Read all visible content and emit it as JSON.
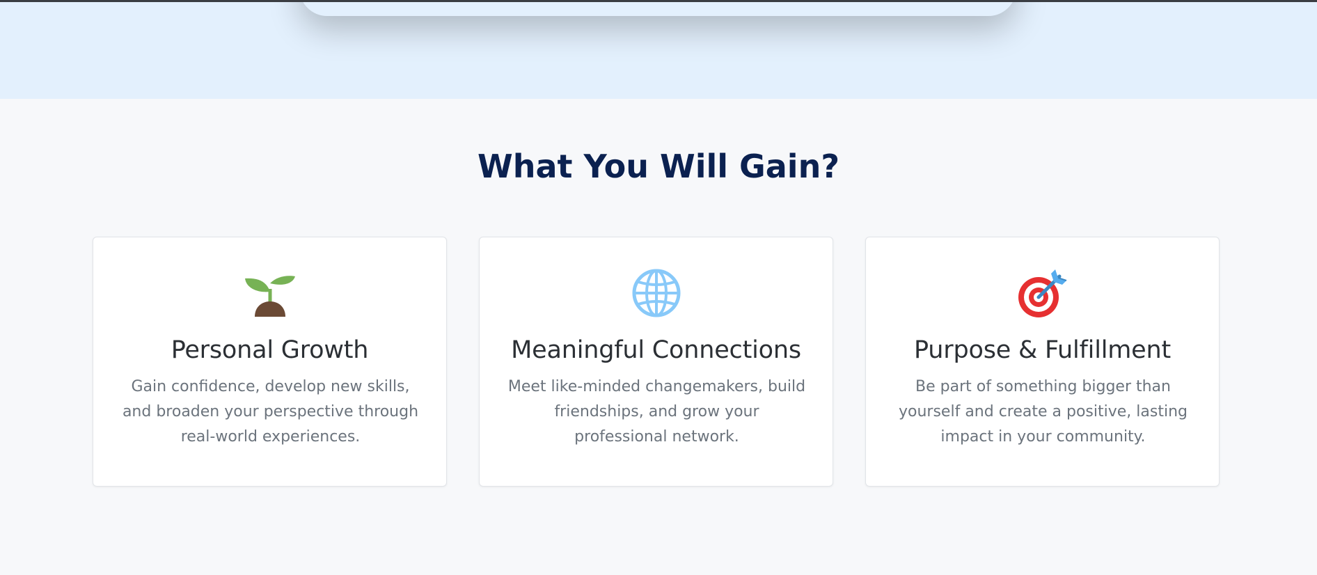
{
  "section": {
    "title": "What You Will Gain?"
  },
  "cards": [
    {
      "icon": "seedling-icon",
      "title": "Personal Growth",
      "text": "Gain confidence, develop new skills, and broaden your perspective through real-world experiences."
    },
    {
      "icon": "globe-icon",
      "title": "Meaningful Connections",
      "text": "Meet like-minded changemakers, build friendships, and grow your professional network."
    },
    {
      "icon": "target-icon",
      "title": "Purpose & Fulfillment",
      "text": "Be part of something bigger than yourself and create a positive, lasting impact in your community."
    }
  ],
  "colors": {
    "heading": "#0b2150",
    "card_title": "#2b2f34",
    "card_text": "#6b737c",
    "hero_band": "#e3f0fd",
    "page_bg": "#f7f8fa"
  }
}
